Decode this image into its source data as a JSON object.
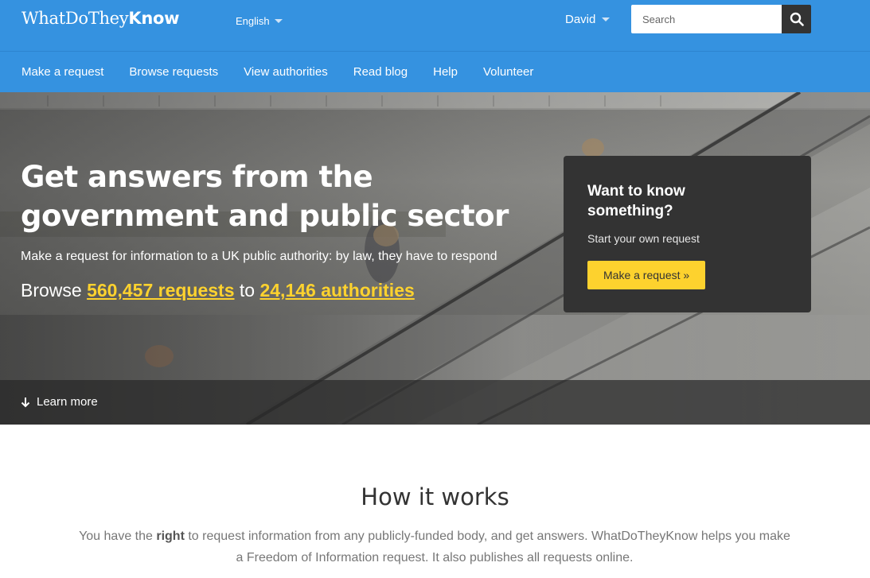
{
  "header": {
    "logo_plain": "WhatDoThey",
    "logo_bold": "Know",
    "language": "English",
    "user": "David",
    "search_placeholder": "Search",
    "colors": {
      "bar": "#3592e0",
      "search_button": "#333333"
    }
  },
  "nav": {
    "items": [
      {
        "label": "Make a request"
      },
      {
        "label": "Browse requests"
      },
      {
        "label": "View authorities"
      },
      {
        "label": "Read blog"
      },
      {
        "label": "Help"
      },
      {
        "label": "Volunteer"
      }
    ]
  },
  "hero": {
    "title": "Get answers from the government and public sector",
    "subtitle": "Make a request for information to a UK public authority: by law, they have to respond",
    "browse_prefix": "Browse",
    "requests_link": "560,457 requests",
    "browse_middle": "to",
    "authorities_link": "24,146 authorities",
    "learn_more": "Learn more",
    "accent_color": "#fdd22e"
  },
  "card": {
    "title": "Want to know something?",
    "subtitle": "Start your own request",
    "button": "Make a request »"
  },
  "how": {
    "title": "How it works",
    "text_prefix": "You have the",
    "text_bold": "right",
    "text_suffix": "to request information from any publicly-funded body, and get answers. WhatDoTheyKnow helps you make a Freedom of Information request. It also publishes all requests online."
  },
  "icons": {
    "search": "search-icon",
    "language_caret": "chevron-down-icon",
    "user_caret": "chevron-down-icon",
    "learn_more": "arrow-down-icon"
  }
}
